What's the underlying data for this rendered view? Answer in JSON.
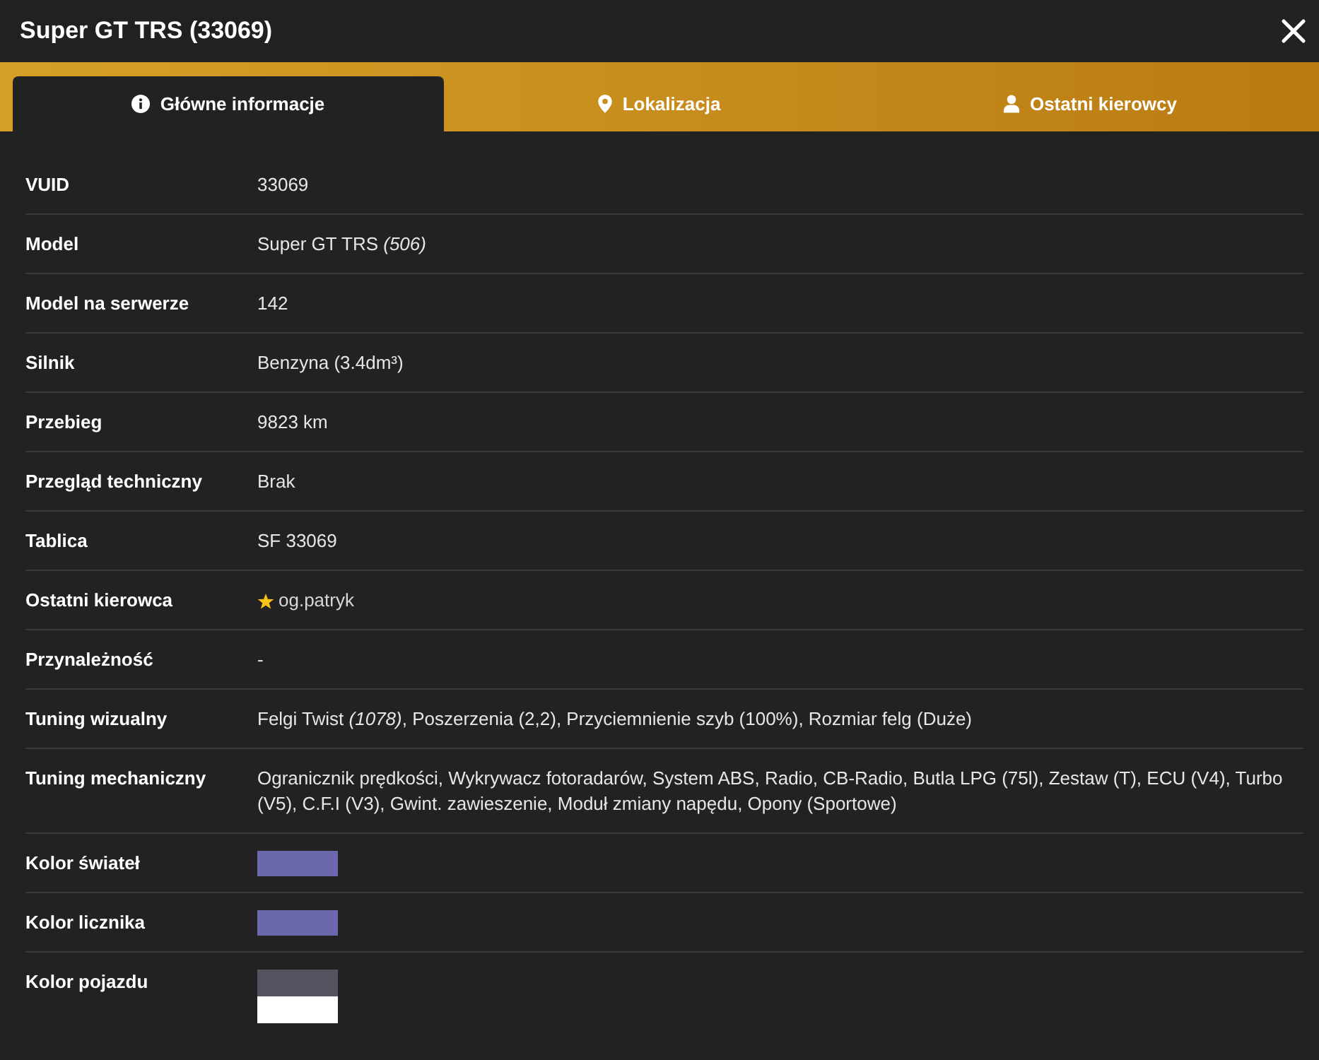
{
  "window": {
    "title": "Super GT TRS (33069)"
  },
  "tabs": [
    {
      "label": "Główne informacje",
      "kind": "info",
      "selected": true
    },
    {
      "label": "Lokalizacja",
      "kind": "location",
      "selected": false
    },
    {
      "label": "Ostatni kierowcy",
      "kind": "user",
      "selected": false
    }
  ],
  "details": [
    {
      "label": "VUID",
      "kind": "text",
      "value": "33069"
    },
    {
      "label": "Model",
      "kind": "text",
      "value": "Super GT TRS *(506)*"
    },
    {
      "label": "Model na serwerze",
      "kind": "text",
      "value": "142"
    },
    {
      "label": "Silnik",
      "kind": "text",
      "value": "Benzyna (3.4dm³)"
    },
    {
      "label": "Przebieg",
      "kind": "text",
      "value": "9823 km"
    },
    {
      "label": "Przegląd techniczny",
      "kind": "text",
      "value": "Brak"
    },
    {
      "label": "Tablica",
      "kind": "text",
      "value": "SF 33069"
    },
    {
      "label": "Ostatni kierowca",
      "kind": "driver",
      "value": "og.patryk",
      "starred": true
    },
    {
      "label": "Przynależność",
      "kind": "text",
      "value": "-"
    },
    {
      "label": "Tuning wizualny",
      "kind": "text",
      "value": "Felgi Twist *(1078)*, Poszerzenia (2,2), Przyciemnienie szyb (100%), Rozmiar felg (Duże)"
    },
    {
      "label": "Tuning mechaniczny",
      "kind": "text",
      "value": "Ogranicznik prędkości, Wykrywacz fotoradarów, System ABS, Radio, CB-Radio, Butla LPG (75l), Zestaw (T), ECU (V4), Turbo (V5), C.F.I (V3), Gwint. zawieszenie, Moduł zmiany napędu, Opony (Sportowe)"
    },
    {
      "label": "Kolor świateł",
      "kind": "colors",
      "colors": [
        {
          "color": "#6b68ae"
        }
      ]
    },
    {
      "label": "Kolor licznika",
      "kind": "colors",
      "colors": [
        {
          "color": "#6b68ae"
        }
      ]
    },
    {
      "label": "Kolor pojazdu",
      "kind": "colors",
      "colors": [
        {
          "color": "#545460"
        },
        {
          "color": "#ffffff"
        }
      ]
    }
  ]
}
